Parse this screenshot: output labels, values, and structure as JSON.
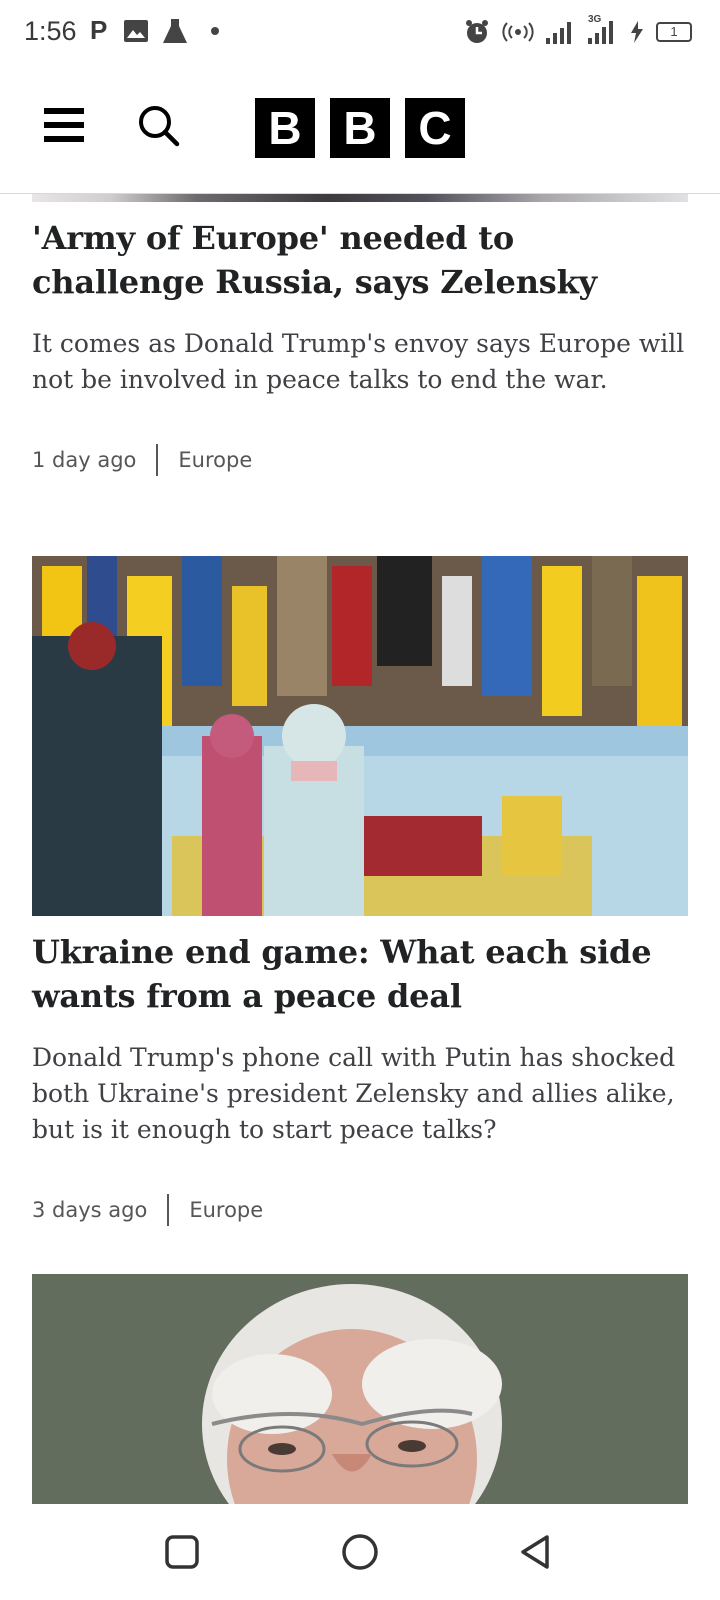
{
  "status_bar": {
    "time": "1:56",
    "left_icons": [
      "parking-icon",
      "image-icon",
      "lab-flask-icon",
      "dot-icon"
    ],
    "right_icons": [
      "alarm-icon",
      "hotspot-icon",
      "signal-icon",
      "signal-3g-icon",
      "charging-icon",
      "battery-icon"
    ],
    "network_label": "3G",
    "battery_label": "1"
  },
  "header": {
    "logo_letters": [
      "B",
      "B",
      "C"
    ],
    "icons": [
      "menu-icon",
      "search-icon"
    ]
  },
  "articles": [
    {
      "headline": "'Army of Europe' needed to challenge Russia, says Zelensky",
      "summary": "It comes as Donald Trump's envoy says Europe will not be involved in peace talks to end the war.",
      "time": "1 day ago",
      "section": "Europe"
    },
    {
      "image_alt": "People at a memorial of flags in Kyiv",
      "headline": "Ukraine end game: What each side wants from a peace deal",
      "summary": "Donald Trump's phone call with Putin has shocked both Ukraine's president Zelensky and allies alike, but is it enough to start peace talks?",
      "time": "3 days ago",
      "section": "Europe"
    },
    {
      "image_alt": "Portrait of an elderly man with glasses"
    }
  ],
  "nav_bar": {
    "icons": [
      "recents-square-icon",
      "home-circle-icon",
      "back-triangle-icon"
    ]
  }
}
